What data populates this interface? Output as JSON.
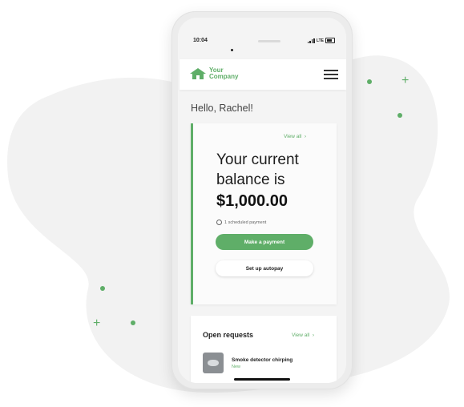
{
  "status_bar": {
    "time": "10:04",
    "network": "LTE"
  },
  "header": {
    "logo_line1": "Your",
    "logo_line2": "Company"
  },
  "greeting": "Hello, Rachel!",
  "balance_card": {
    "view_all": "View all",
    "line1": "Your current",
    "line2": "balance is",
    "amount": "$1,000.00",
    "scheduled": "1 scheduled payment",
    "primary_button": "Make a payment",
    "secondary_button": "Set up autopay"
  },
  "open_requests": {
    "title": "Open requests",
    "view_all": "View all",
    "items": [
      {
        "title": "Smoke detector chirping",
        "status": "New"
      }
    ]
  },
  "colors": {
    "accent": "#5fae68",
    "background_blob": "#f2f2f2"
  }
}
